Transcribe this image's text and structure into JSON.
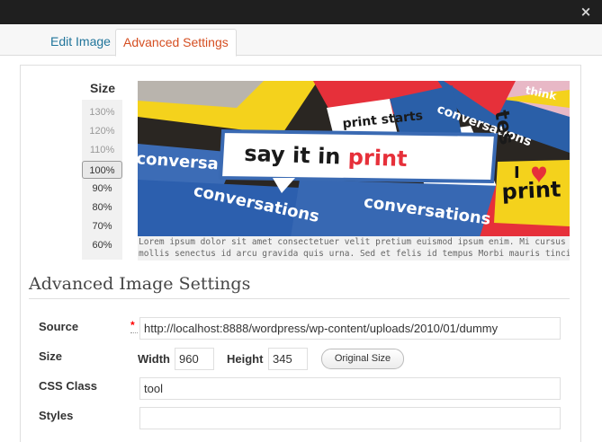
{
  "window": {
    "close_label": "×"
  },
  "tabs": [
    {
      "label": "Edit Image",
      "active": false
    },
    {
      "label": "Advanced Settings",
      "active": true
    }
  ],
  "size_picker": {
    "title": "Size",
    "options": [
      "130%",
      "120%",
      "110%",
      "100%",
      "90%",
      "80%",
      "70%",
      "60%"
    ],
    "selected": "100%"
  },
  "preview": {
    "caption_line1": "Lorem ipsum dolor sit amet consectetuer velit pretium euismod ipsum enim. Mi cursus at a",
    "caption_line2": "mollis senectus id arcu gravida quis urna. Sed et felis id tempus Morbi mauris tincidunt",
    "sticker_texts": {
      "main": "say it in print",
      "main_highlight": "print",
      "conversations": "conversations",
      "conversa": "conversa",
      "print_starts": "print starts",
      "i_print": "print",
      "think": "think",
      "tes": "tes"
    }
  },
  "section": {
    "title": "Advanced Image Settings"
  },
  "fields": {
    "source": {
      "label": "Source",
      "required_mark": "*",
      "value": "http://localhost:8888/wordpress/wp-content/uploads/2010/01/dummy"
    },
    "size": {
      "label": "Size",
      "width_label": "Width",
      "width_value": "960",
      "height_label": "Height",
      "height_value": "345",
      "original_button": "Original Size"
    },
    "css_class": {
      "label": "CSS Class",
      "value": "tool"
    },
    "styles": {
      "label": "Styles",
      "value": ""
    }
  },
  "colors": {
    "link": "#21759b",
    "active_tab": "#d54e21",
    "required": "#ff0000"
  }
}
